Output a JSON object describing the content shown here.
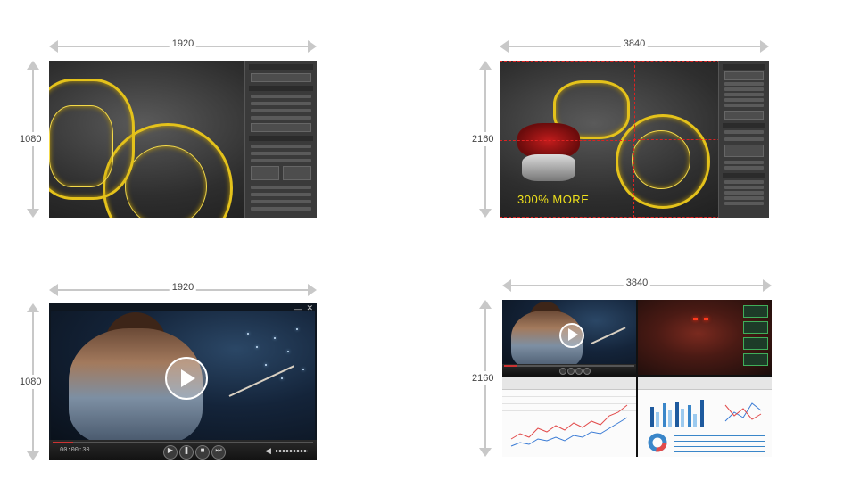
{
  "panels": [
    {
      "id": "top-left",
      "width_label": "1920",
      "height_label": "1080"
    },
    {
      "id": "top-right",
      "width_label": "3840",
      "height_label": "2160",
      "overlay_text": "300% MORE"
    },
    {
      "id": "bottom-left",
      "width_label": "1920",
      "height_label": "1080",
      "timecode": "00:00:30"
    },
    {
      "id": "bottom-right",
      "width_label": "3840",
      "height_label": "2160"
    }
  ],
  "icons": {
    "play": "play-icon",
    "close": "close-icon",
    "minimize": "minimize-icon"
  },
  "colors": {
    "wireframe": "#e4c21b",
    "dashed_outline": "#d22222",
    "dimension_arrow": "#c8c8c8"
  }
}
